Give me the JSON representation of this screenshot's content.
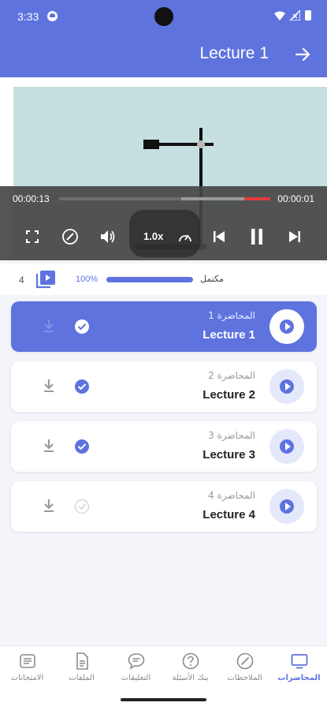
{
  "status_bar": {
    "time": "3:33"
  },
  "header": {
    "title": "Lecture 1"
  },
  "player": {
    "current_time": "00:00:13",
    "duration": "00:00:01",
    "speed": "1.0x",
    "buffered_fraction": 0.88,
    "played_fraction": 1.0
  },
  "progress": {
    "count": "4",
    "percent": "100%",
    "fraction": 1.0,
    "label": "مكتمل"
  },
  "lectures": [
    {
      "arabic": "المحاضرة 1",
      "title": "Lecture 1",
      "completed": true,
      "active": true
    },
    {
      "arabic": "المحاضرة 2",
      "title": "Lecture 2",
      "completed": true,
      "active": false
    },
    {
      "arabic": "المحاضرة 3",
      "title": "Lecture 3",
      "completed": true,
      "active": false
    },
    {
      "arabic": "المحاضرة 4",
      "title": "Lecture 4",
      "completed": false,
      "active": false
    }
  ],
  "bottom_nav": [
    {
      "label": "الامتحانات",
      "icon": "exam-icon"
    },
    {
      "label": "الملفات",
      "icon": "file-icon"
    },
    {
      "label": "التعليقات",
      "icon": "comment-icon"
    },
    {
      "label": "بنك الأسئلة",
      "icon": "question-icon"
    },
    {
      "label": "الملاحظات",
      "icon": "notes-icon"
    },
    {
      "label": "المحاضرات",
      "icon": "tv-icon",
      "active": true
    }
  ],
  "colors": {
    "primary": "#5e73de",
    "primary_light": "#e4e8fb",
    "played": "#e23b3b",
    "background": "#f4f5fa"
  }
}
